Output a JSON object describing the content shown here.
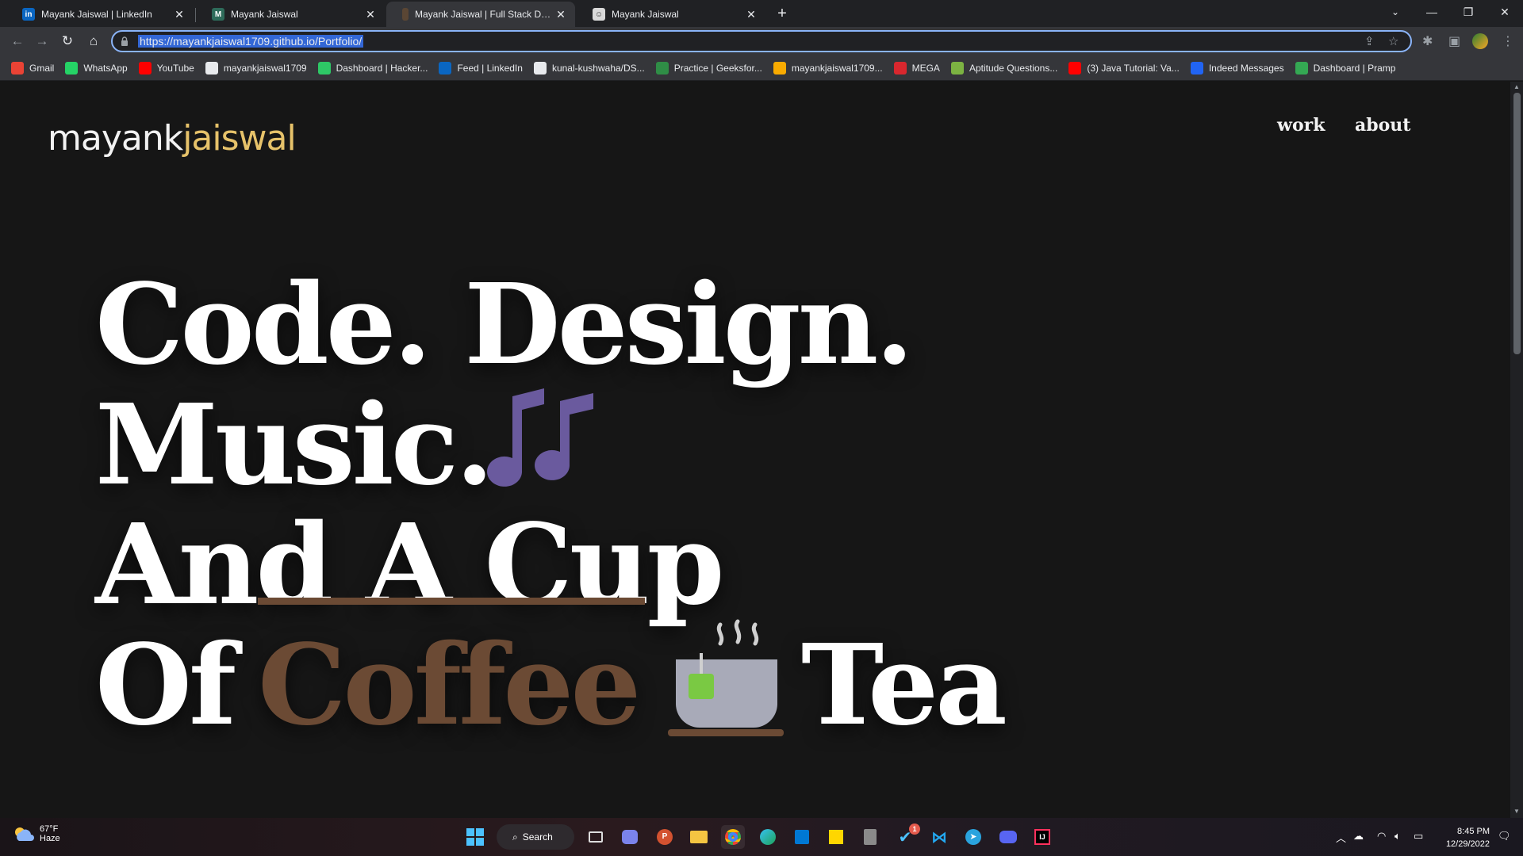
{
  "browser": {
    "tabs": [
      {
        "title": "Mayank Jaiswal | LinkedIn",
        "icon": "linkedin-icon",
        "active": false
      },
      {
        "title": "Mayank Jaiswal",
        "icon": "site-icon",
        "active": false
      },
      {
        "title": "Mayank Jaiswal | Full Stack Devel",
        "icon": "site-icon",
        "active": true
      },
      {
        "title": "Mayank Jaiswal",
        "icon": "avatar-icon",
        "active": false
      }
    ],
    "new_tab": "+",
    "url": "https://mayankjaiswal1709.github.io/Portfolio/",
    "bookmarks": [
      {
        "label": "Gmail",
        "icon": "gmail-icon",
        "color": "#ea4335"
      },
      {
        "label": "WhatsApp",
        "icon": "whatsapp-icon",
        "color": "#25d366"
      },
      {
        "label": "YouTube",
        "icon": "youtube-icon",
        "color": "#ff0000"
      },
      {
        "label": "mayankjaiswal1709",
        "icon": "github-icon",
        "color": "#e8eaed"
      },
      {
        "label": "Dashboard | Hacker...",
        "icon": "hackerrank-icon",
        "color": "#2ec866"
      },
      {
        "label": "Feed | LinkedIn",
        "icon": "linkedin-icon",
        "color": "#0a66c2"
      },
      {
        "label": "kunal-kushwaha/DS...",
        "icon": "github-icon",
        "color": "#e8eaed"
      },
      {
        "label": "Practice | Geeksfor...",
        "icon": "gfg-icon",
        "color": "#2f8d46"
      },
      {
        "label": "mayankjaiswal1709...",
        "icon": "chart-icon",
        "color": "#f9ab00"
      },
      {
        "label": "MEGA",
        "icon": "mega-icon",
        "color": "#d9272e"
      },
      {
        "label": "Aptitude Questions...",
        "icon": "leaf-icon",
        "color": "#7cb342"
      },
      {
        "label": "(3) Java Tutorial: Va...",
        "icon": "youtube-icon",
        "color": "#ff0000"
      },
      {
        "label": "Indeed Messages",
        "icon": "indeed-icon",
        "color": "#2164f3"
      },
      {
        "label": "Dashboard | Pramp",
        "icon": "pramp-icon",
        "color": "#34a853"
      }
    ]
  },
  "site": {
    "logo_part1": "mayank",
    "logo_part2": "jaiswal",
    "nav_work": "work",
    "nav_about": "about",
    "hero_line1": "Code. Design.",
    "hero_line2": "Music.",
    "hero_line3": "And A Cup",
    "hero_line4_a": "Of",
    "hero_line4_b": "Coffee",
    "hero_line4_c": "Tea",
    "colors": {
      "accent": "#e6c26a",
      "background": "#161616",
      "coffee": "#6b4a34",
      "music": "#6a5a9e",
      "tea_cup": "#a8aab8",
      "tea_bag": "#7ac943"
    }
  },
  "taskbar": {
    "weather_temp": "67°F",
    "weather_desc": "Haze",
    "search_label": "Search",
    "time": "8:45 PM",
    "date": "12/29/2022",
    "badge_count": "1"
  }
}
